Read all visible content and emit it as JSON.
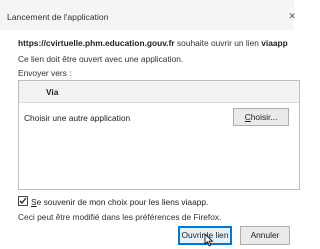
{
  "dialog": {
    "title": "Lancement de l'application",
    "message_url": "https://cvirtuelle.phm.education.gouv.fr",
    "message_rest": " souhaite ouvrir un lien ",
    "message_scheme": "viaapp",
    "message_line2": "Ce lien doit être ouvert avec une application.",
    "send_to": "Envoyer vers :",
    "list": {
      "header": "Via",
      "rows": [
        {
          "label": "Choisir une autre application",
          "button_prefix": "",
          "button_underlined": "C",
          "button_rest": "hoisir..."
        }
      ]
    },
    "remember": {
      "checked": true,
      "label_underlined": "S",
      "label_rest": "e souvenir de mon choix pour les liens viaapp."
    },
    "footnote": "Ceci peut être modifié dans les préférences de Firefox.",
    "buttons": {
      "open": "Ouvrir le lien",
      "cancel": "Annuler"
    }
  },
  "icons": {
    "close": "close-icon",
    "checkmark": "checkmark-icon",
    "cursor": "mouse-pointer-icon"
  }
}
